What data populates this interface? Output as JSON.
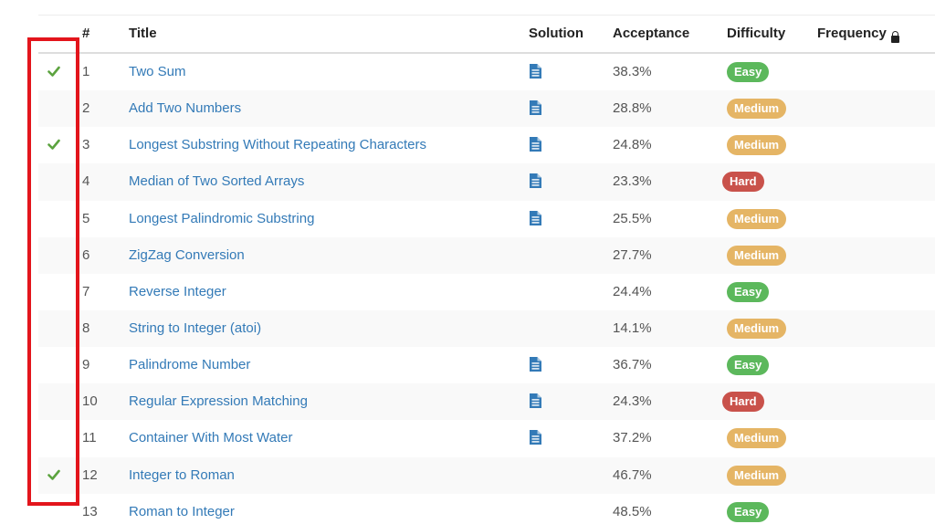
{
  "table": {
    "headers": {
      "number": "#",
      "title": "Title",
      "solution": "Solution",
      "acceptance": "Acceptance",
      "difficulty": "Difficulty",
      "frequency": "Frequency"
    },
    "frequency_icon": "lock-icon",
    "colors": {
      "link": "#337ab7",
      "check": "#5ca33f",
      "easy": "#5cb85c",
      "medium": "#e5b565",
      "hard": "#c9524b",
      "highlight": "#e3151c"
    },
    "rows": [
      {
        "solved": true,
        "number": "1",
        "title": "Two Sum",
        "solution": true,
        "acceptance": "38.3%",
        "difficulty": "Easy"
      },
      {
        "solved": false,
        "number": "2",
        "title": "Add Two Numbers",
        "solution": true,
        "acceptance": "28.8%",
        "difficulty": "Medium"
      },
      {
        "solved": true,
        "number": "3",
        "title": "Longest Substring Without Repeating Characters",
        "solution": true,
        "acceptance": "24.8%",
        "difficulty": "Medium"
      },
      {
        "solved": false,
        "number": "4",
        "title": "Median of Two Sorted Arrays",
        "solution": true,
        "acceptance": "23.3%",
        "difficulty": "Hard"
      },
      {
        "solved": false,
        "number": "5",
        "title": "Longest Palindromic Substring",
        "solution": true,
        "acceptance": "25.5%",
        "difficulty": "Medium"
      },
      {
        "solved": false,
        "number": "6",
        "title": "ZigZag Conversion",
        "solution": false,
        "acceptance": "27.7%",
        "difficulty": "Medium"
      },
      {
        "solved": false,
        "number": "7",
        "title": "Reverse Integer",
        "solution": false,
        "acceptance": "24.4%",
        "difficulty": "Easy"
      },
      {
        "solved": false,
        "number": "8",
        "title": "String to Integer (atoi)",
        "solution": false,
        "acceptance": "14.1%",
        "difficulty": "Medium"
      },
      {
        "solved": false,
        "number": "9",
        "title": "Palindrome Number",
        "solution": true,
        "acceptance": "36.7%",
        "difficulty": "Easy"
      },
      {
        "solved": false,
        "number": "10",
        "title": "Regular Expression Matching",
        "solution": true,
        "acceptance": "24.3%",
        "difficulty": "Hard"
      },
      {
        "solved": false,
        "number": "11",
        "title": "Container With Most Water",
        "solution": true,
        "acceptance": "37.2%",
        "difficulty": "Medium"
      },
      {
        "solved": true,
        "number": "12",
        "title": "Integer to Roman",
        "solution": false,
        "acceptance": "46.7%",
        "difficulty": "Medium"
      },
      {
        "solved": false,
        "number": "13",
        "title": "Roman to Integer",
        "solution": false,
        "acceptance": "48.5%",
        "difficulty": "Easy"
      }
    ]
  }
}
